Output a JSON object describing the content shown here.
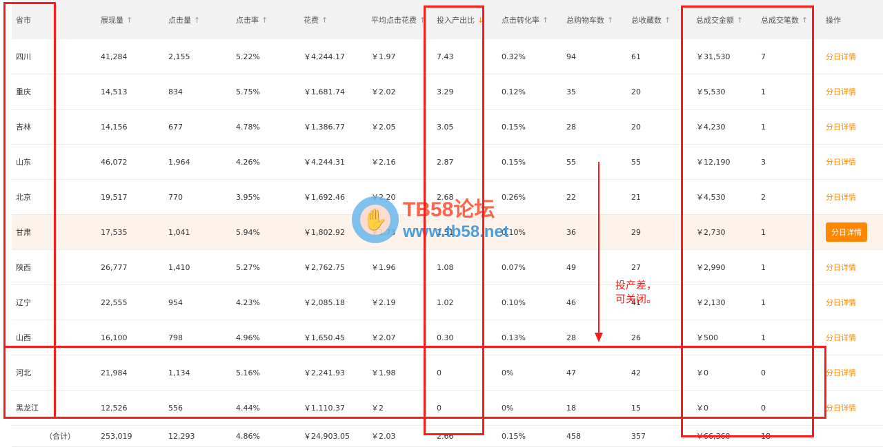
{
  "headers": [
    {
      "label": "省市",
      "arrow": ""
    },
    {
      "label": "展现量",
      "arrow": "↑"
    },
    {
      "label": "点击量",
      "arrow": "↑"
    },
    {
      "label": "点击率",
      "arrow": "↑"
    },
    {
      "label": "花费",
      "arrow": "↑"
    },
    {
      "label": "平均点击花费",
      "arrow": "↑"
    },
    {
      "label": "投入产出比",
      "arrow": "↓"
    },
    {
      "label": "点击转化率",
      "arrow": "↑"
    },
    {
      "label": "总购物车数",
      "arrow": "↑"
    },
    {
      "label": "总收藏数",
      "arrow": "↑"
    },
    {
      "label": "总成交金额",
      "arrow": "↑"
    },
    {
      "label": "总成交笔数",
      "arrow": "↑"
    },
    {
      "label": "操作",
      "arrow": ""
    }
  ],
  "rows": [
    [
      "四川",
      "41,284",
      "2,155",
      "5.22%",
      "￥4,244.17",
      "￥1.97",
      "7.43",
      "0.32%",
      "94",
      "61",
      "￥31,530",
      "7",
      "分日详情"
    ],
    [
      "重庆",
      "14,513",
      "834",
      "5.75%",
      "￥1,681.74",
      "￥2.02",
      "3.29",
      "0.12%",
      "35",
      "20",
      "￥5,530",
      "1",
      "分日详情"
    ],
    [
      "吉林",
      "14,156",
      "677",
      "4.78%",
      "￥1,386.77",
      "￥2.05",
      "3.05",
      "0.15%",
      "28",
      "20",
      "￥4,230",
      "1",
      "分日详情"
    ],
    [
      "山东",
      "46,072",
      "1,964",
      "4.26%",
      "￥4,244.31",
      "￥2.16",
      "2.87",
      "0.15%",
      "55",
      "55",
      "￥12,190",
      "3",
      "分日详情"
    ],
    [
      "北京",
      "19,517",
      "770",
      "3.95%",
      "￥1,692.46",
      "￥2.20",
      "2.68",
      "0.26%",
      "22",
      "21",
      "￥4,530",
      "2",
      "分日详情"
    ],
    [
      "甘肃",
      "17,535",
      "1,041",
      "5.94%",
      "￥1,802.92",
      "￥1.73",
      "1.51",
      "0.10%",
      "36",
      "29",
      "￥2,730",
      "1",
      "分日详情"
    ],
    [
      "陕西",
      "26,777",
      "1,410",
      "5.27%",
      "￥2,762.75",
      "￥1.96",
      "1.08",
      "0.07%",
      "49",
      "27",
      "￥2,990",
      "1",
      "分日详情"
    ],
    [
      "辽宁",
      "22,555",
      "954",
      "4.23%",
      "￥2,085.18",
      "￥2.19",
      "1.02",
      "0.10%",
      "46",
      "41",
      "￥2,130",
      "1",
      "分日详情"
    ],
    [
      "山西",
      "16,100",
      "798",
      "4.96%",
      "￥1,650.45",
      "￥2.07",
      "0.30",
      "0.13%",
      "28",
      "26",
      "￥500",
      "1",
      "分日详情"
    ],
    [
      "河北",
      "21,984",
      "1,134",
      "5.16%",
      "￥2,241.93",
      "￥1.98",
      "0",
      "0%",
      "47",
      "42",
      "￥0",
      "0",
      "分日详情"
    ],
    [
      "黑龙江",
      "12,526",
      "556",
      "4.44%",
      "￥1,110.37",
      "￥2",
      "0",
      "0%",
      "18",
      "15",
      "￥0",
      "0",
      "分日详情"
    ]
  ],
  "highlight_row": 5,
  "total": [
    "（合计）",
    "253,019",
    "12,293",
    "4.86%",
    "￥24,903.05",
    "￥2.03",
    "2.66",
    "0.15%",
    "458",
    "357",
    "￥66,360",
    "18",
    ""
  ],
  "watermark": {
    "title": "TB58论坛",
    "url": "www.tb58.net"
  },
  "annotation": {
    "line1": "投产差，",
    "line2": "可关闭。"
  },
  "colors": {
    "accent": "#ff8800",
    "annotation_red": "#ff1a1a"
  }
}
